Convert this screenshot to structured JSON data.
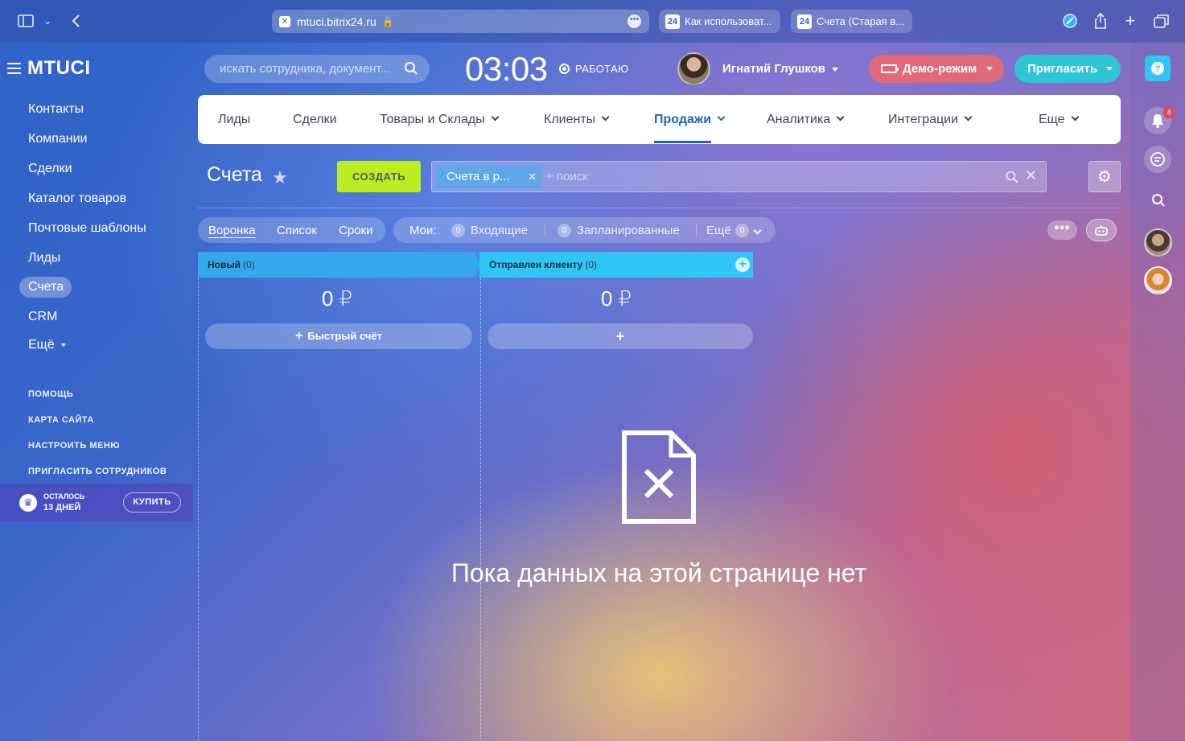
{
  "browser": {
    "url": "mtuci.bitrix24.ru",
    "tabs": [
      {
        "label": "Как использоват...",
        "favicon": "24"
      },
      {
        "label": "Счета (Старая в...",
        "favicon": "24"
      }
    ]
  },
  "sidebar": {
    "logo": "MTUCI",
    "items": [
      {
        "label": "Контакты"
      },
      {
        "label": "Компании"
      },
      {
        "label": "Сделки"
      },
      {
        "label": "Каталог товаров"
      },
      {
        "label": "Почтовые шаблоны"
      },
      {
        "label": "Лиды"
      },
      {
        "label": "Счета",
        "active": true
      },
      {
        "label": "CRM"
      },
      {
        "label": "Ещё"
      }
    ],
    "footer_links": [
      "ПОМОЩЬ",
      "КАРТА САЙТА",
      "НАСТРОИТЬ МЕНЮ",
      "ПРИГЛАСИТЬ СОТРУДНИКОВ"
    ],
    "trial": {
      "line1": "ОСТАЛОСЬ",
      "line2": "13 ДНЕЙ",
      "buy_label": "КУПИТЬ"
    }
  },
  "header": {
    "search_placeholder": "искать сотрудника, документ...",
    "clock": "03:03",
    "work_status": "РАБОТАЮ",
    "user_name": "Игнатий Глушков",
    "demo_label": "Демо-режим",
    "invite_label": "Пригласить"
  },
  "top_menu": {
    "items": [
      {
        "label": "Лиды",
        "dropdown": false
      },
      {
        "label": "Сделки",
        "dropdown": false
      },
      {
        "label": "Товары и Склады",
        "dropdown": true
      },
      {
        "label": "Клиенты",
        "dropdown": true
      },
      {
        "label": "Продажи",
        "dropdown": true,
        "active": true
      },
      {
        "label": "Аналитика",
        "dropdown": true
      },
      {
        "label": "Интеграции",
        "dropdown": true
      },
      {
        "label": "Еще",
        "dropdown": true
      }
    ]
  },
  "page": {
    "title": "Счета",
    "create_label": "СОЗДАТЬ",
    "filter_chip": "Счета в р...",
    "filter_placeholder": "+ поиск"
  },
  "view_switch": {
    "items": [
      "Воронка",
      "Список",
      "Сроки"
    ],
    "active": "Воронка"
  },
  "counters": {
    "label": "Мои:",
    "incoming_count": "0",
    "incoming_label": "Входящие",
    "planned_count": "0",
    "planned_label": "Запланированные",
    "more_label": "Ещё",
    "more_count": "0"
  },
  "kanban": {
    "columns": [
      {
        "title": "Новый",
        "count": "(0)",
        "sum": "0 ₽",
        "button_label": "Быстрый счёт"
      },
      {
        "title": "Отправлен клиенту",
        "count": "(0)",
        "sum": "0 ₽",
        "button_label": "+"
      }
    ]
  },
  "empty_state": {
    "text": "Пока данных на этой странице нет"
  },
  "right_rail": {
    "notification_count": "4"
  },
  "colors": {
    "create_button": "#bbed21",
    "column_new": "#35a8ec",
    "column_sent": "#2fc6f6",
    "demo_button": "#e06a7c",
    "invite_button": "#2ec5d4",
    "active_menu": "#2067b0"
  },
  "icons": [
    "sidebar-toggle-icon",
    "back-arrow-icon",
    "lock-icon",
    "share-icon",
    "new-tab-icon",
    "tabs-overview-icon",
    "search-icon",
    "star-icon",
    "gear-icon",
    "robot-icon",
    "empty-document-icon",
    "bell-icon",
    "chat-icon",
    "help-icon",
    "crown-icon",
    "battery-icon"
  ]
}
